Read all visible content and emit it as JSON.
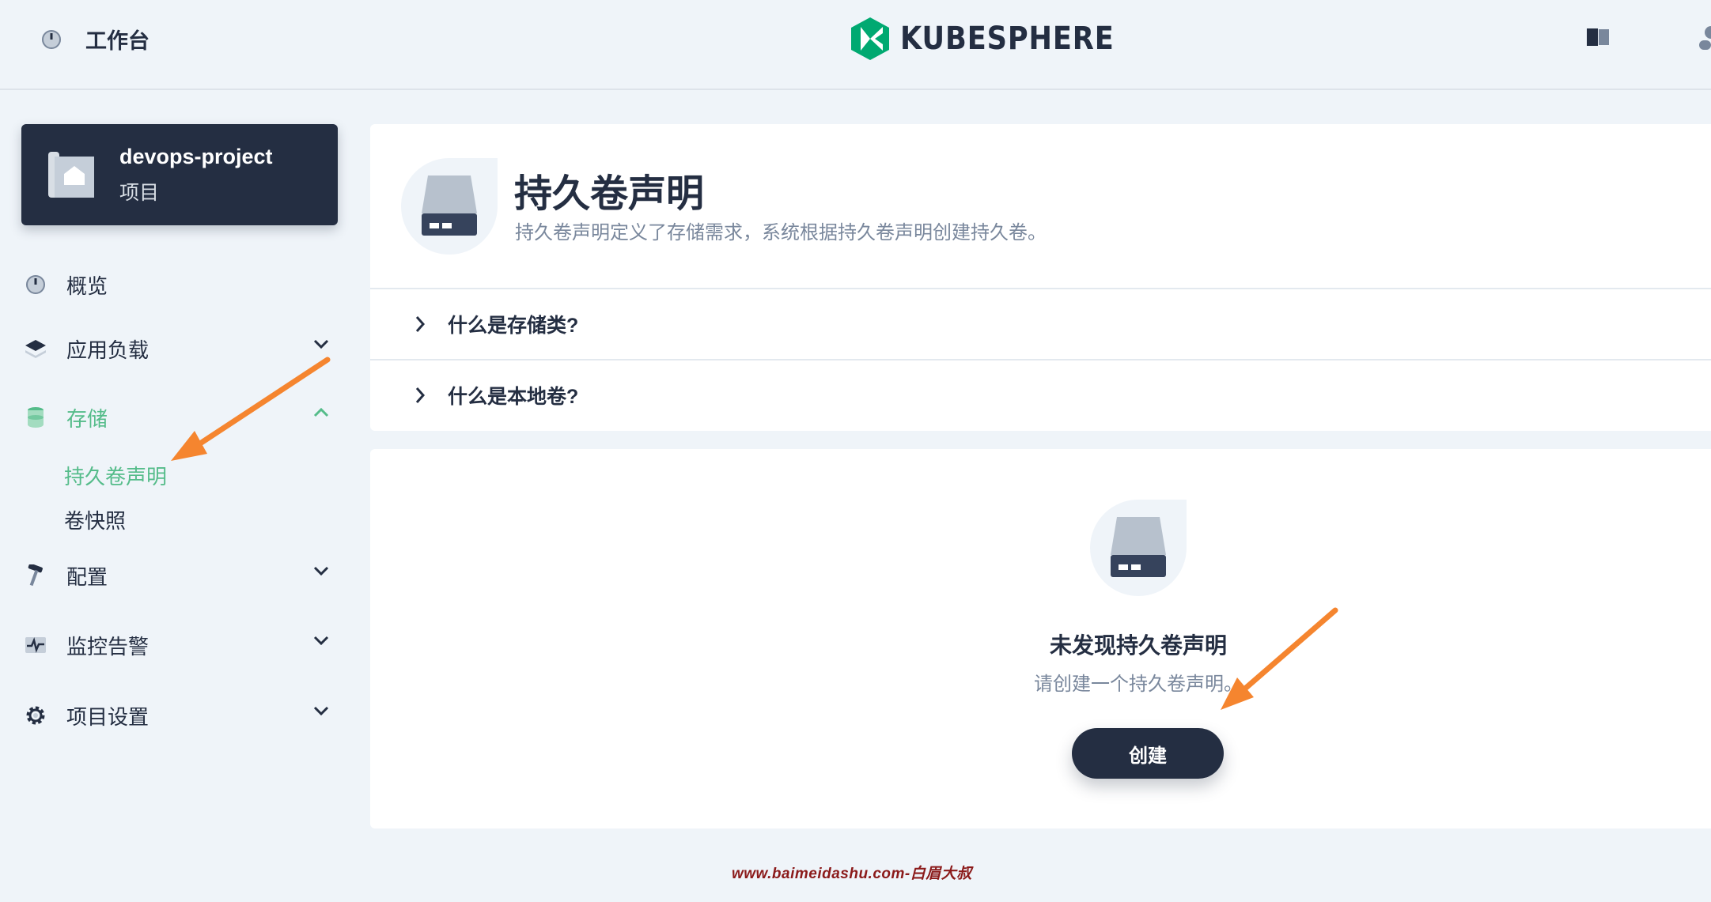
{
  "header": {
    "workbench_label": "工作台",
    "brand": "KUBESPHERE"
  },
  "project": {
    "name": "devops-project",
    "type_label": "项目"
  },
  "sidebar": {
    "items": [
      {
        "label": "概览",
        "icon": "dashboard-icon"
      },
      {
        "label": "应用负载",
        "icon": "layers-icon"
      },
      {
        "label": "存储",
        "icon": "database-icon",
        "expanded": true
      },
      {
        "label": "配置",
        "icon": "hammer-icon"
      },
      {
        "label": "监控告警",
        "icon": "monitor-icon"
      },
      {
        "label": "项目设置",
        "icon": "gear-icon"
      }
    ],
    "storage_children": [
      "持久卷声明",
      "卷快照"
    ]
  },
  "page": {
    "title": "持久卷声明",
    "description": "持久卷声明定义了存储需求，系统根据持久卷声明创建持久卷。",
    "faq": [
      "什么是存储类?",
      "什么是本地卷?"
    ]
  },
  "empty_state": {
    "title": "未发现持久卷声明",
    "description": "请创建一个持久卷声明。",
    "create_label": "创建"
  },
  "watermark": "www.baimeidashu.com-白眉大叔",
  "colors": {
    "active": "#55bc8a",
    "dark": "#242e42",
    "muted": "#79879c",
    "annotation_arrow": "#f5852f"
  }
}
